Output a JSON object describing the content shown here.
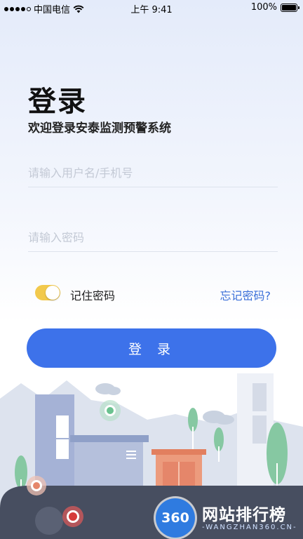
{
  "status_bar": {
    "carrier": "中国电信",
    "time": "上午  9:41",
    "battery": "100%"
  },
  "header": {
    "title": "登录",
    "subtitle": "欢迎登录安泰监测预警系统"
  },
  "form": {
    "username_placeholder": "请输入用户名/手机号",
    "username_value": "",
    "password_placeholder": "请输入密码",
    "password_value": ""
  },
  "remember": {
    "label": "记住密码",
    "enabled": true,
    "toggle_color": "#f2c94c"
  },
  "forgot_label": "忘记密码?",
  "login_label": "登 录",
  "colors": {
    "primary": "#3d72ea",
    "link": "#3a6fd8"
  },
  "watermark": {
    "badge": "360",
    "title": "网站排行榜",
    "subtitle": "-WANGZHAN360.CN-"
  }
}
